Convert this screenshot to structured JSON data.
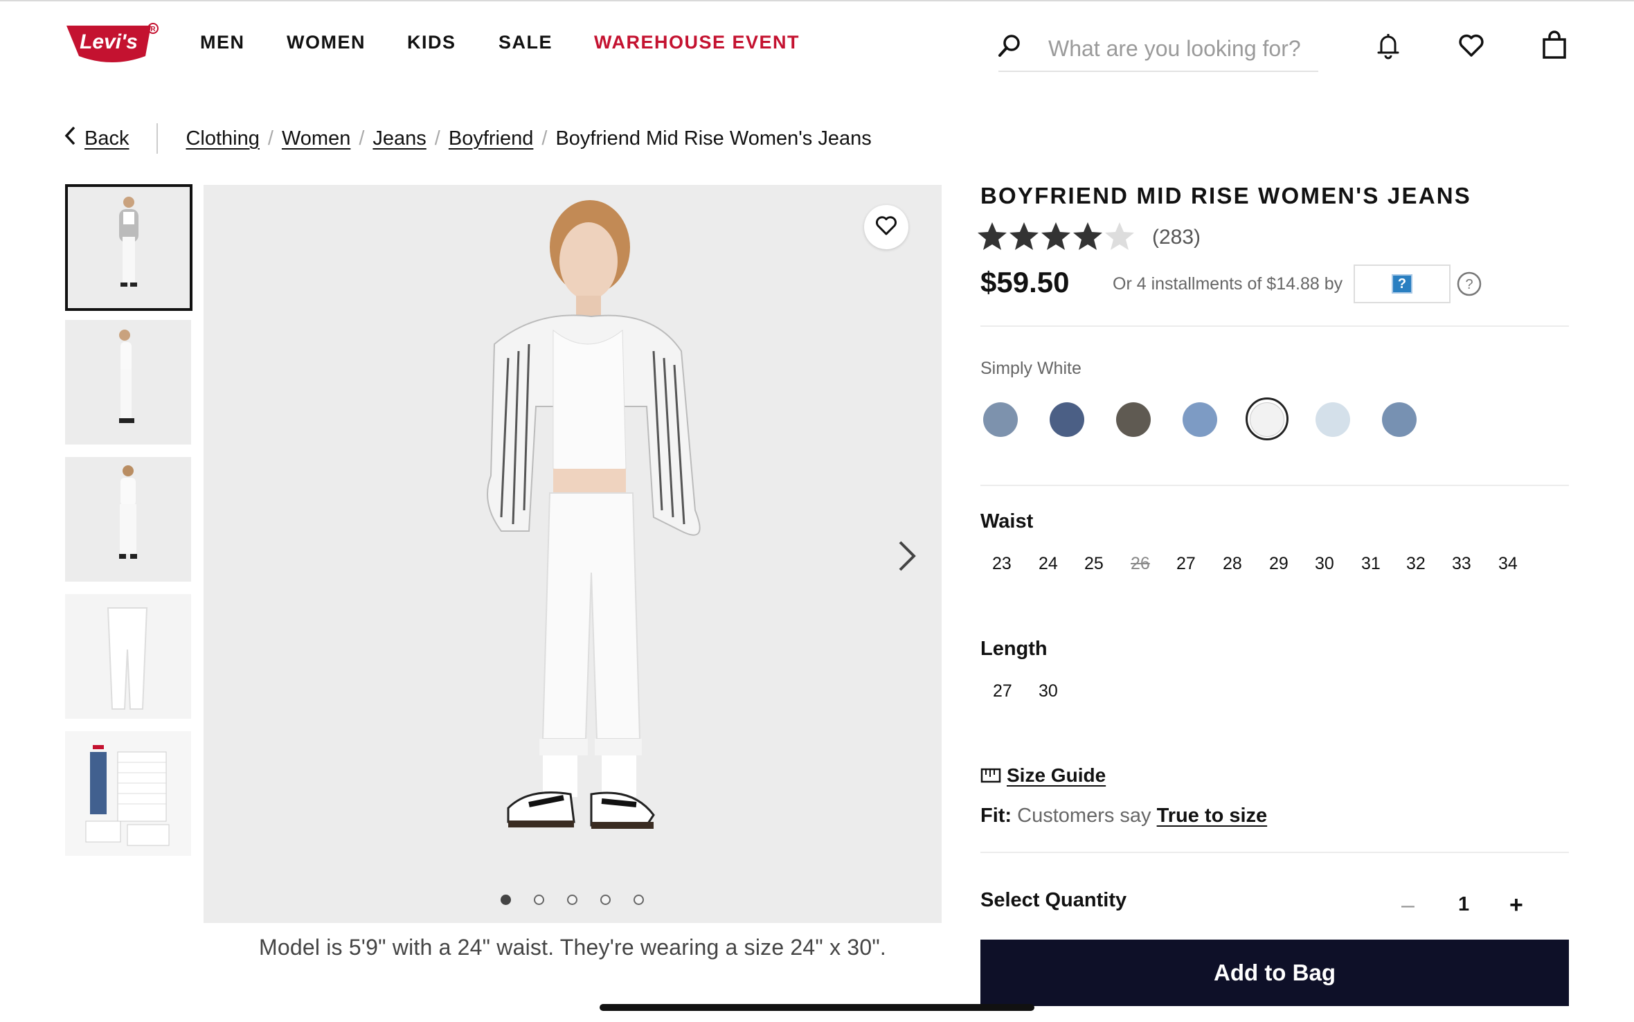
{
  "brand": {
    "logo_text": "Levi's",
    "logo_color": "#c41230"
  },
  "nav": {
    "items": [
      "MEN",
      "WOMEN",
      "KIDS",
      "SALE"
    ],
    "highlight": "WAREHOUSE EVENT",
    "highlight_color": "#c41230"
  },
  "search": {
    "placeholder": "What are you looking for?",
    "icon": "search-icon"
  },
  "header_icons": [
    "bell-icon",
    "heart-icon",
    "shopping-bag-icon"
  ],
  "breadcrumb": {
    "back": "Back",
    "links": [
      "Clothing",
      "Women",
      "Jeans",
      "Boyfriend"
    ],
    "current": "Boyfriend Mid Rise Women's Jeans"
  },
  "gallery": {
    "thumbnail_count": 5,
    "selected_thumbnail": 1,
    "dots": 5,
    "active_dot": 1,
    "caption": "Model is 5'9\" with a 24\" waist. They're wearing a size 24\" x 30\"."
  },
  "product": {
    "title": "BOYFRIEND MID RISE WOMEN'S JEANS",
    "rating": 4,
    "rating_max": 5,
    "reviews": "(283)",
    "price": "$59.50",
    "installments": "Or 4 installments of $14.88 by",
    "afterpay_placeholder": "?",
    "color_name": "Simply White",
    "swatches": [
      "#7d92ad",
      "#4b5f85",
      "#5f5a52",
      "#7d9bc4",
      "#f2f2f2",
      "#d4e0ea",
      "#7791b2"
    ],
    "selected_swatch": 5,
    "waist_label": "Waist",
    "waist_sizes": [
      "23",
      "24",
      "25",
      "26",
      "27",
      "28",
      "29",
      "30",
      "31",
      "32",
      "33",
      "34"
    ],
    "waist_unavailable": [
      "26"
    ],
    "length_label": "Length",
    "length_sizes": [
      "27",
      "30"
    ],
    "size_guide": "Size Guide",
    "fit_label": "Fit:",
    "fit_text": "Customers say",
    "fit_link": "True to size",
    "quantity_label": "Select Quantity",
    "quantity_minus": "–",
    "quantity": "1",
    "quantity_plus": "+",
    "add_to_bag": "Add to Bag"
  }
}
